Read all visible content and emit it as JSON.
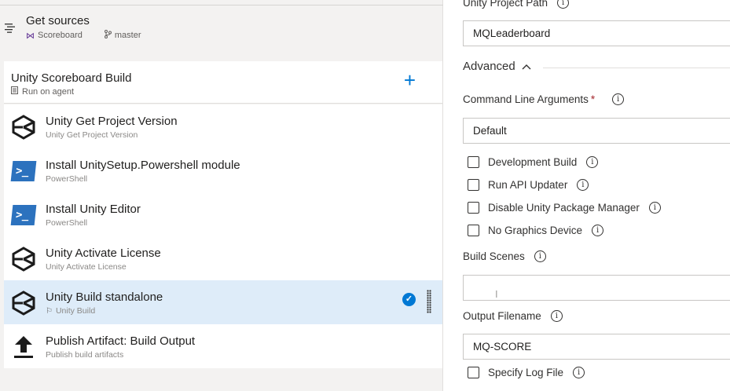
{
  "sources": {
    "title": "Get sources",
    "repo": "Scoreboard",
    "branch": "master"
  },
  "job": {
    "title": "Unity Scoreboard Build",
    "subtitle": "Run on agent",
    "add_icon": "plus-icon"
  },
  "tasks": [
    {
      "name": "Unity Get Project Version",
      "kind": "Unity Get Project Version",
      "icon": "unity-icon"
    },
    {
      "name": "Install UnitySetup.Powershell module",
      "kind": "PowerShell",
      "icon": "powershell-icon"
    },
    {
      "name": "Install Unity Editor",
      "kind": "PowerShell",
      "icon": "powershell-icon"
    },
    {
      "name": "Unity Activate License",
      "kind": "Unity Activate License",
      "icon": "unity-icon"
    },
    {
      "name": "Unity Build standalone",
      "kind": "Unity Build",
      "icon": "unity-icon",
      "selected": true
    },
    {
      "name": "Publish Artifact: Build Output",
      "kind": "Publish build artifacts",
      "icon": "upload-icon"
    }
  ],
  "settings": {
    "project_path_label": "Unity Project Path",
    "project_path_value": "MQLeaderboard",
    "advanced_label": "Advanced",
    "cmd_args_label": "Command Line Arguments",
    "cmd_args_required": "*",
    "cmd_args_value": "Default",
    "checkboxes": [
      {
        "label": "Development Build",
        "checked": false
      },
      {
        "label": "Run API Updater",
        "checked": false
      },
      {
        "label": "Disable Unity Package Manager",
        "checked": false
      },
      {
        "label": "No Graphics Device",
        "checked": false
      }
    ],
    "build_scenes_label": "Build Scenes",
    "build_scenes_value": "",
    "output_filename_label": "Output Filename",
    "output_filename_value": "MQ-SCORE",
    "log_file_label": "Specify Log File"
  },
  "colors": {
    "accent": "#0078d4",
    "selected_row": "#deecf9",
    "powershell": "#2c72be",
    "required": "#a4262c"
  }
}
